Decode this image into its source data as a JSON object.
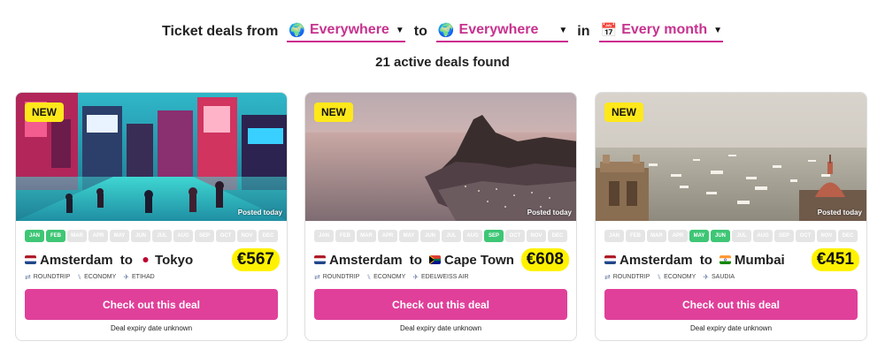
{
  "filters": {
    "prefix": "Ticket deals from",
    "from_value": "Everywhere",
    "connector_to": "to",
    "to_value": "Everywhere",
    "connector_in": "in",
    "when_value": "Every month",
    "globe_glyph": "🌍",
    "calendar_glyph": "📅",
    "caret_glyph": "▼"
  },
  "summary": {
    "count_text": "21 active deals found"
  },
  "accent_color": "#e0409a",
  "price_highlight": "#fff200",
  "month_active_color": "#3ec675",
  "months": [
    "JAN",
    "FEB",
    "MAR",
    "APR",
    "MAY",
    "JUN",
    "JUL",
    "AUG",
    "SEP",
    "OCT",
    "NOV",
    "DEC"
  ],
  "cards": [
    {
      "badge": "NEW",
      "posted": "Posted today",
      "image_subject": "tokyo-street-night",
      "active_months": [
        "JAN",
        "FEB"
      ],
      "from_flag": "netherlands-flag",
      "origin": "Amsterdam",
      "route_to": "to",
      "dest_flag": "japan-flag",
      "destination": "Tokyo",
      "price": "€567",
      "trip_type": "ROUNDTRIP",
      "cabin": "ECONOMY",
      "airline": "ETIHAD",
      "cta": "Check out this deal",
      "expiry": "Deal expiry date unknown"
    },
    {
      "badge": "NEW",
      "posted": "Posted today",
      "image_subject": "cape-town-sunset",
      "active_months": [
        "SEP"
      ],
      "from_flag": "netherlands-flag",
      "origin": "Amsterdam",
      "route_to": "to",
      "dest_flag": "south-africa-flag",
      "destination": "Cape Town",
      "price": "€608",
      "trip_type": "ROUNDTRIP",
      "cabin": "ECONOMY",
      "airline": "EDELWEISS AIR",
      "cta": "Check out this deal",
      "expiry": "Deal expiry date unknown"
    },
    {
      "badge": "NEW",
      "posted": "Posted today",
      "image_subject": "mumbai-gateway-harbour",
      "active_months": [
        "MAY",
        "JUN"
      ],
      "from_flag": "netherlands-flag",
      "origin": "Amsterdam",
      "route_to": "to",
      "dest_flag": "india-flag",
      "destination": "Mumbai",
      "price": "€451",
      "trip_type": "ROUNDTRIP",
      "cabin": "ECONOMY",
      "airline": "SAUDIA",
      "cta": "Check out this deal",
      "expiry": "Deal expiry date unknown"
    }
  ]
}
